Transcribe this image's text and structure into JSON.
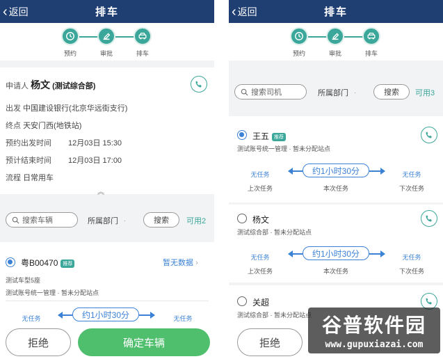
{
  "common": {
    "back_label": "返回",
    "title": "排车",
    "steps": [
      "预约",
      "审批",
      "排车"
    ],
    "reject_label": "拒绝",
    "confirm_label": "确定车辆"
  },
  "left": {
    "applicant": {
      "label": "申请人",
      "name": "杨文",
      "dept": "(测试综合部)"
    },
    "details": [
      {
        "key": "出发",
        "value": "中国建设银行(北京华远街支行)"
      },
      {
        "key": "终点",
        "value": "天安门西(地铁站)"
      },
      {
        "key": "预约出发时间",
        "value": "12月03日 15:30"
      },
      {
        "key": "预计结束时间",
        "value": "12月03日 17:00"
      },
      {
        "key": "流程",
        "value": "日常用车"
      }
    ],
    "search": {
      "placeholder": "搜索车辆",
      "dept": "所属部门",
      "button": "搜索",
      "available": "可用2"
    },
    "vehicle": {
      "plate": "粤B00470",
      "tag": "推荐",
      "no_data": "暂无数据",
      "model": "测试车型5座",
      "driver": "测试账号统一管理 · 暂未分配站点",
      "prev_task": "无任务",
      "duration": "约1小时30分",
      "next_task": "无任务"
    }
  },
  "right": {
    "search": {
      "placeholder": "搜索司机",
      "dept": "所属部门",
      "button": "搜索",
      "available": "可用3"
    },
    "task_captions": {
      "prev": "上次任务",
      "current": "本次任务",
      "next": "下次任务"
    },
    "drivers": [
      {
        "name": "王五",
        "tag": "推荐",
        "sub": "测试账号统一管理 · 暂未分配站点",
        "prev": "无任务",
        "duration": "约1小时30分",
        "next": "无任务"
      },
      {
        "name": "杨文",
        "sub": "测试综合部 · 暂未分配站点",
        "prev": "无任务",
        "duration": "约1小时30分",
        "next": "无任务"
      },
      {
        "name": "关超",
        "sub": "测试综合部 · 暂未分配站点"
      }
    ]
  },
  "watermark": {
    "brand": "谷普软件园",
    "url": "www.gupuxiazai.com"
  },
  "colors": {
    "navbar": "#1f3f73",
    "accent": "#3aa79a",
    "link": "#3b82d6",
    "confirm": "#4fbf6e"
  }
}
